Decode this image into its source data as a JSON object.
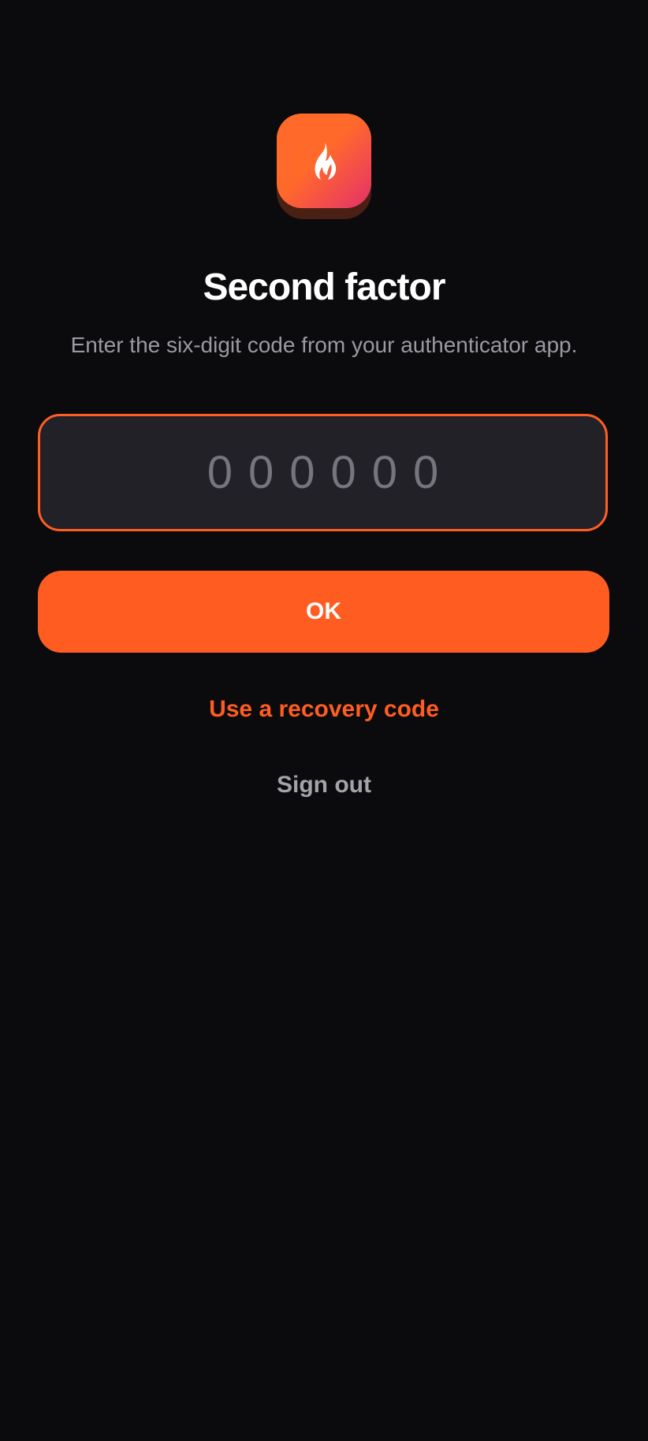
{
  "app": {
    "logo_icon": "flame-icon",
    "accent_color": "#ff5c22",
    "background_color": "#0b0b0d"
  },
  "header": {
    "title": "Second factor",
    "subtitle": "Enter the six-digit code from your authenticator app."
  },
  "code_field": {
    "value": "",
    "placeholder": "000000"
  },
  "actions": {
    "ok_label": "OK",
    "recovery_label": "Use a recovery code",
    "signout_label": "Sign out"
  }
}
